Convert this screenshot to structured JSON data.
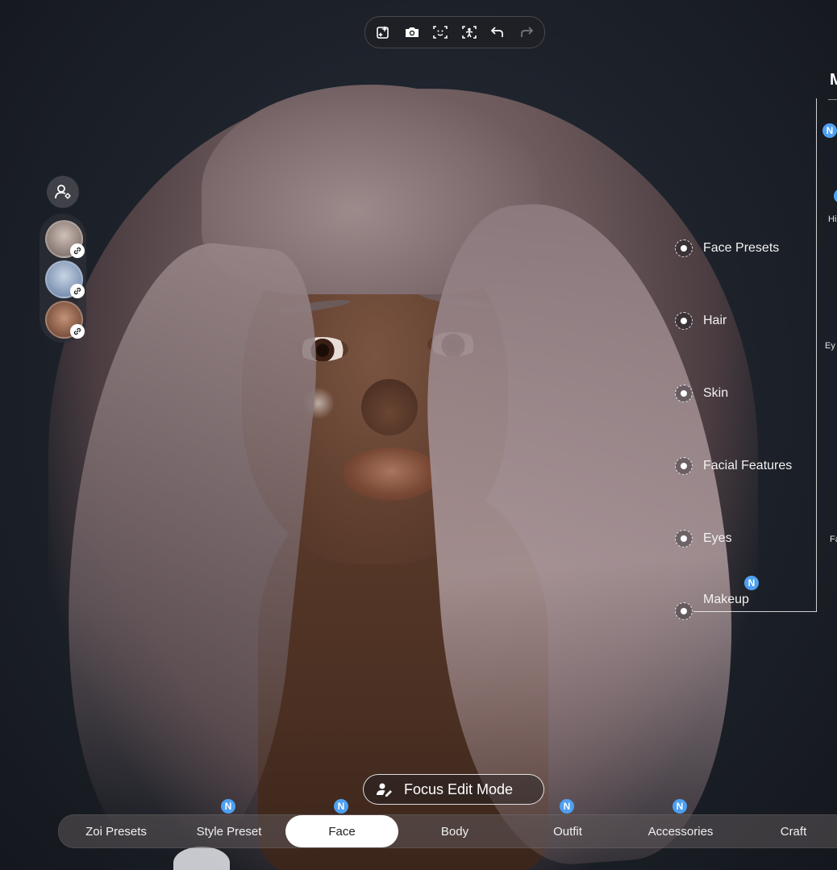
{
  "toolbar": {
    "buttons": [
      {
        "icon": "ai-sparkle-icon"
      },
      {
        "icon": "camera-icon"
      },
      {
        "icon": "face-scan-icon"
      },
      {
        "icon": "body-scan-icon"
      },
      {
        "icon": "undo-icon"
      },
      {
        "icon": "redo-icon",
        "disabled": true
      }
    ]
  },
  "left_panel": {
    "profile_icon": "profile-settings-icon",
    "avatars": [
      {
        "icon": "link-icon"
      },
      {
        "icon": "link-icon"
      },
      {
        "icon": "link-icon"
      }
    ]
  },
  "focus_points": [
    {
      "label": "Face Presets"
    },
    {
      "label": "Hair"
    },
    {
      "label": "Skin"
    },
    {
      "label": "Facial Features"
    },
    {
      "label": "Eyes"
    },
    {
      "label": "Makeup",
      "badge": "N"
    }
  ],
  "right_panel": {
    "title": "M",
    "badge": "N",
    "clipped_labels": [
      "Hi",
      "Ey",
      "Fa"
    ]
  },
  "focus_edit": {
    "label": "Focus Edit Mode",
    "icon": "person-edit-icon"
  },
  "tabs": [
    {
      "label": "Zoi Presets"
    },
    {
      "label": "Style Preset",
      "badge": "N"
    },
    {
      "label": "Face",
      "badge": "N",
      "active": true
    },
    {
      "label": "Body"
    },
    {
      "label": "Outfit",
      "badge": "N"
    },
    {
      "label": "Accessories",
      "badge": "N"
    },
    {
      "label": "Craft"
    }
  ],
  "colors": {
    "accent_badge": "#4ea0f2",
    "active_tab": "#ffffff"
  }
}
